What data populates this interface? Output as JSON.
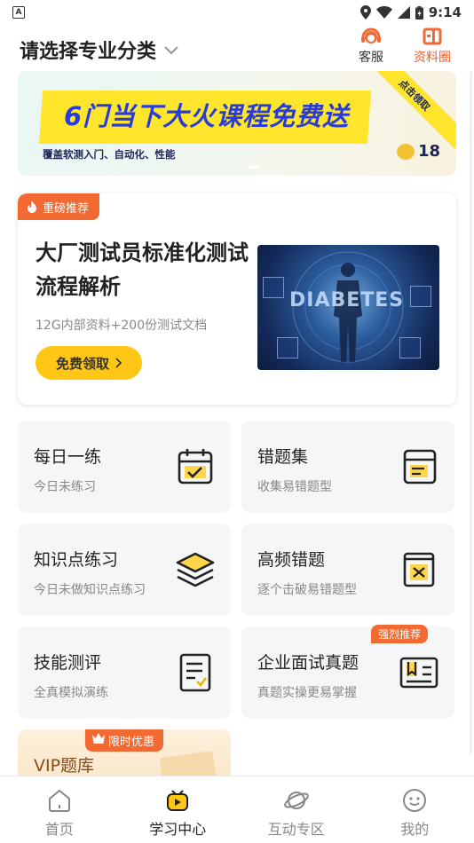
{
  "status_bar": {
    "left_icon": "A",
    "time": "9:14"
  },
  "header": {
    "category_label": "请选择专业分类",
    "service_label": "客服",
    "material_label": "资料圈"
  },
  "banner": {
    "title": "6门当下大火课程免费送",
    "subtitle": "覆盖软测入门、自动化、性能",
    "corner": "点击领取",
    "badge_number": "18"
  },
  "recommend": {
    "tag": "重磅推荐",
    "title": "大厂测试员标准化测试流程解析",
    "desc": "12G内部资料+200份测试文档",
    "button": "免费领取",
    "image_text": "DIABETES"
  },
  "tiles": [
    {
      "name": "每日一练",
      "desc": "今日未练习",
      "icon": "calendar-check-icon"
    },
    {
      "name": "错题集",
      "desc": "收集易错题型",
      "icon": "notebook-icon"
    },
    {
      "name": "知识点练习",
      "desc": "今日未做知识点练习",
      "icon": "layers-icon"
    },
    {
      "name": "高频错题",
      "desc": "逐个击破易错题型",
      "icon": "book-x-icon"
    },
    {
      "name": "技能测评",
      "desc": "全真模拟演练",
      "icon": "checklist-icon"
    },
    {
      "name": "企业面试真题",
      "desc": "真题实操更易掌握",
      "icon": "open-book-icon",
      "tag": "强烈推荐"
    }
  ],
  "vip": {
    "tag": "限时优惠",
    "title": "VIP题库"
  },
  "tabbar": [
    {
      "label": "首页",
      "icon": "home-icon"
    },
    {
      "label": "学习中心",
      "icon": "play-icon",
      "active": true
    },
    {
      "label": "互动专区",
      "icon": "planet-icon"
    },
    {
      "label": "我的",
      "icon": "smile-icon"
    }
  ],
  "colors": {
    "accent": "#f26a31",
    "yellow": "#ffc715",
    "banner_title": "#2a3cd8"
  }
}
